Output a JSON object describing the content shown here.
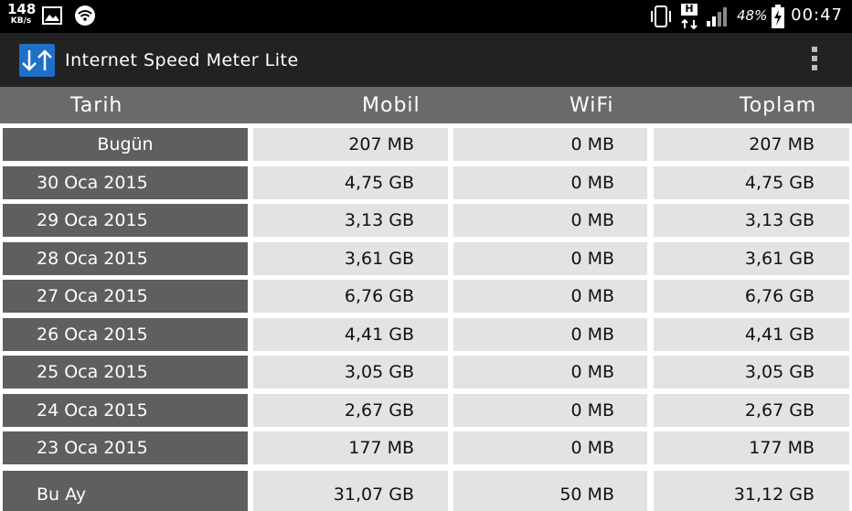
{
  "status_bar": {
    "speed_value": "148",
    "speed_unit": "KB/s",
    "network_type": "H",
    "battery_percent": "48%",
    "time": "00:47"
  },
  "app": {
    "title": "Internet Speed Meter Lite"
  },
  "table": {
    "headers": {
      "date": "Tarih",
      "mobile": "Mobil",
      "wifi": "WiFi",
      "total": "Toplam"
    },
    "rows": [
      {
        "date": "Bugün",
        "mobile": "207 MB",
        "wifi": "0 MB",
        "total": "207 MB"
      },
      {
        "date": "30 Oca 2015",
        "mobile": "4,75 GB",
        "wifi": "0 MB",
        "total": "4,75 GB"
      },
      {
        "date": "29 Oca 2015",
        "mobile": "3,13 GB",
        "wifi": "0 MB",
        "total": "3,13 GB"
      },
      {
        "date": "28 Oca 2015",
        "mobile": "3,61 GB",
        "wifi": "0 MB",
        "total": "3,61 GB"
      },
      {
        "date": "27 Oca 2015",
        "mobile": "6,76 GB",
        "wifi": "0 MB",
        "total": "6,76 GB"
      },
      {
        "date": "26 Oca 2015",
        "mobile": "4,41 GB",
        "wifi": "0 MB",
        "total": "4,41 GB"
      },
      {
        "date": "25 Oca 2015",
        "mobile": "3,05 GB",
        "wifi": "0 MB",
        "total": "3,05 GB"
      },
      {
        "date": "24 Oca 2015",
        "mobile": "2,67 GB",
        "wifi": "0 MB",
        "total": "2,67 GB"
      },
      {
        "date": "23 Oca 2015",
        "mobile": "177 MB",
        "wifi": "0 MB",
        "total": "177 MB"
      }
    ],
    "footer": {
      "date": "Bu Ay",
      "mobile": "31,07 GB",
      "wifi": "50 MB",
      "total": "31,12 GB"
    }
  },
  "colors": {
    "status_bar_bg": "#000000",
    "action_bar_bg": "#222222",
    "header_bg": "#6a6a6a",
    "date_cell_bg": "#5f5f5f",
    "value_cell_bg": "#e3e3e3",
    "logo_blue": "#1f6fc6"
  }
}
